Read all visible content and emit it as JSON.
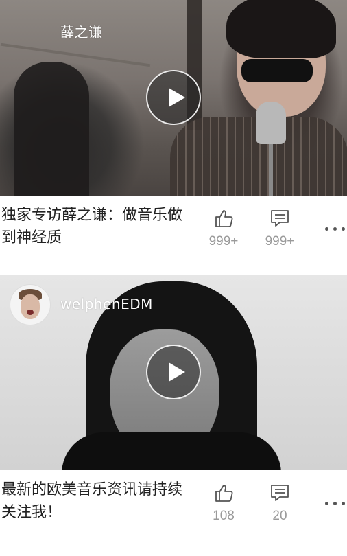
{
  "feed": [
    {
      "author": "薛之谦",
      "title": "独家专访薛之谦：做音乐做到神经质",
      "likes": "999+",
      "comments": "999+"
    },
    {
      "author": "welphenEDM",
      "title": "最新的欧美音乐资讯请持续关注我！",
      "likes": "108",
      "comments": "20"
    }
  ],
  "icons": {
    "play": "play-icon",
    "like": "thumbs-up-icon",
    "comment": "comment-icon",
    "more": "more-dots-icon"
  },
  "colors": {
    "count_text": "#9a9a9a",
    "title_text": "#222222",
    "icon_stroke": "#555555"
  }
}
